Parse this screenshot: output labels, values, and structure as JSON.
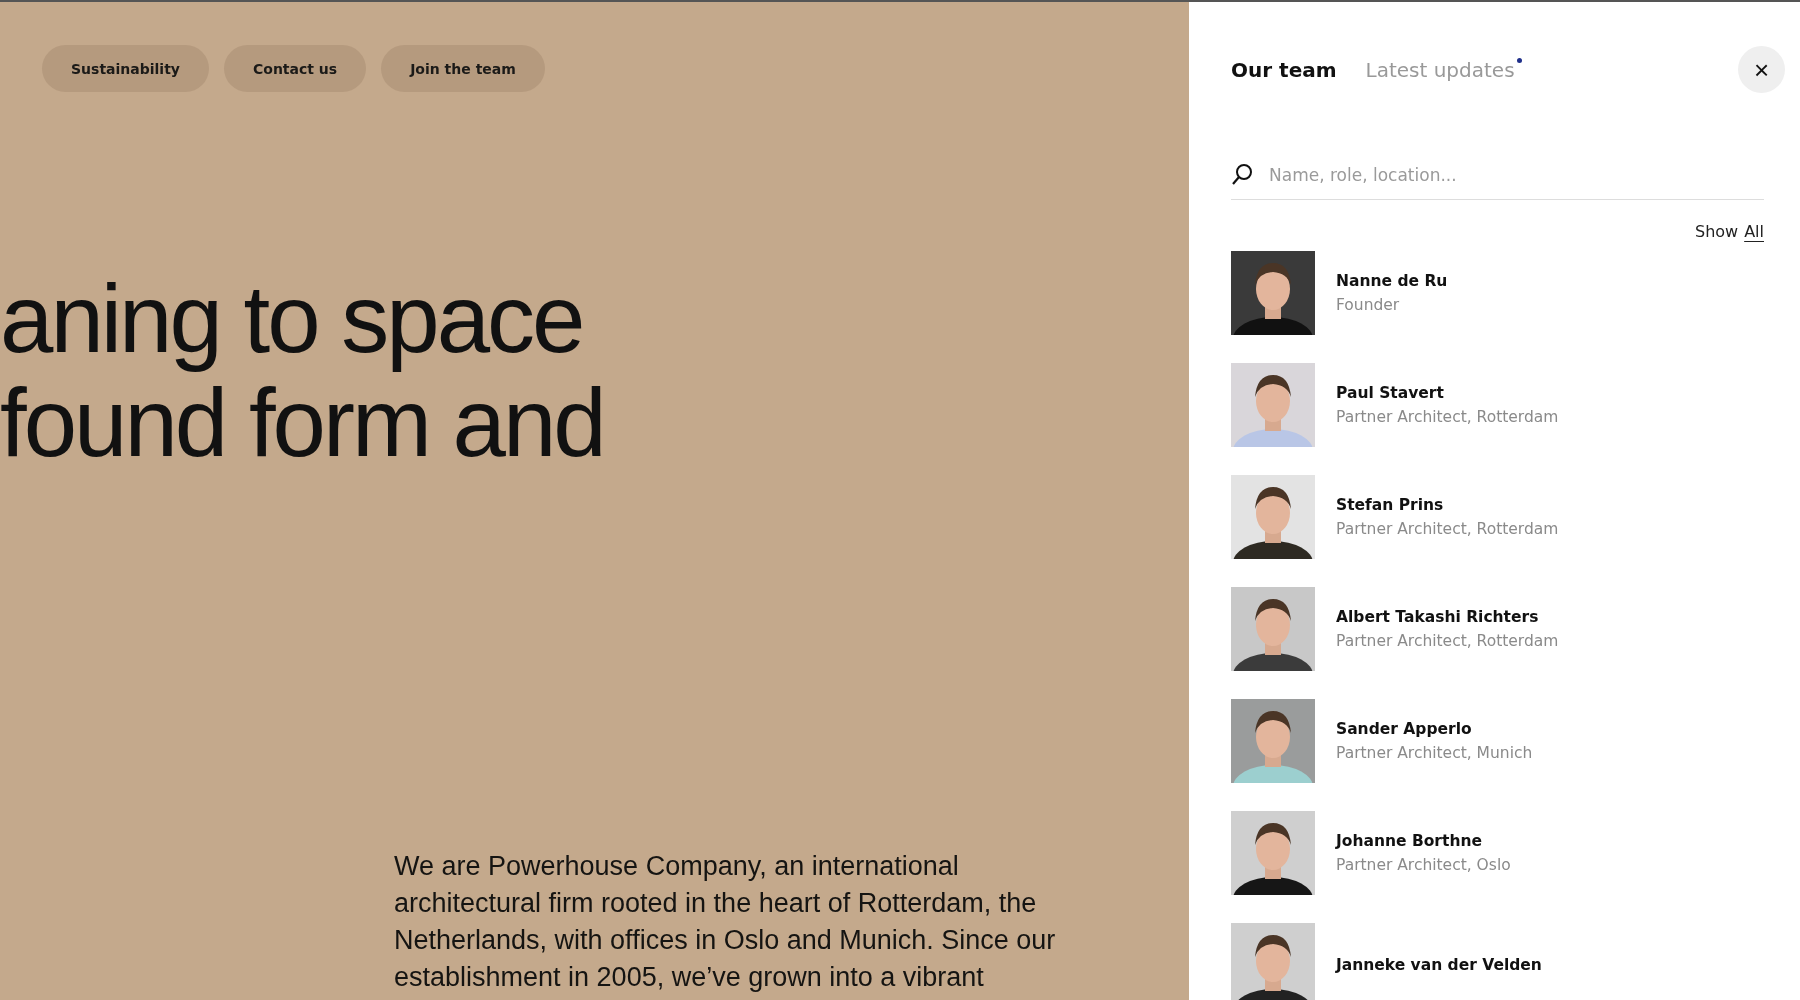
{
  "nav_buttons": [
    "Sustainability",
    "Contact us",
    "Join the team"
  ],
  "headline": [
    "aning to space",
    "found form and"
  ],
  "intro": "We are Powerhouse Company, an international architectural firm rooted in the heart of Rotterdam, the Netherlands, with offices in Oslo and Munich. Since our establishment in 2005, we’ve grown into a vibrant",
  "panel": {
    "tabs": [
      {
        "label": "Our team",
        "selected": true,
        "has_dot": false
      },
      {
        "label": "Latest updates",
        "selected": false,
        "has_dot": true
      }
    ],
    "close": "×",
    "search": {
      "placeholder": "Name, role, location..."
    },
    "show": "Show",
    "show_all": "All",
    "people": [
      {
        "name": "Nanne de Ru",
        "role": "Founder"
      },
      {
        "name": "Paul Stavert",
        "role": "Partner Architect, Rotterdam"
      },
      {
        "name": "Stefan Prins",
        "role": "Partner Architect, Rotterdam"
      },
      {
        "name": "Albert Takashi Richters",
        "role": "Partner Architect, Rotterdam"
      },
      {
        "name": "Sander Apperlo",
        "role": "Partner Architect, Munich"
      },
      {
        "name": "Johanne Borthne",
        "role": "Partner Architect, Oslo"
      },
      {
        "name": "Janneke van der Velden"
      }
    ]
  }
}
